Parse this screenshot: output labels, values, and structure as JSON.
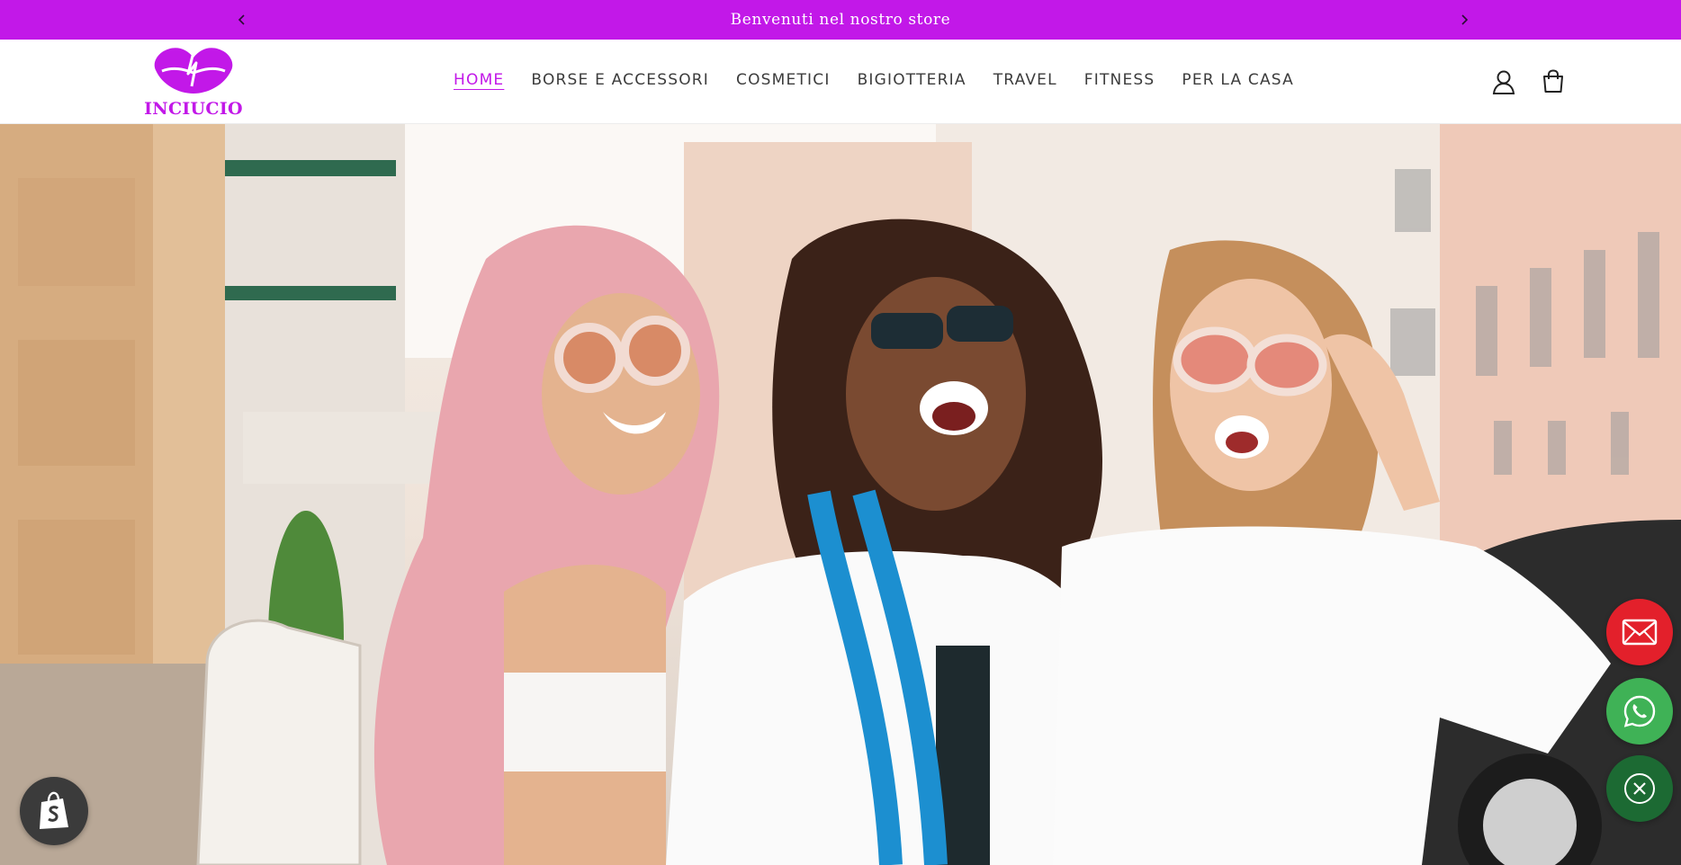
{
  "announcement": {
    "message": "Benvenuti nel nostro store",
    "prev_icon": "chevron-left-icon",
    "next_icon": "chevron-right-icon",
    "background": "#c218e8"
  },
  "header": {
    "logo_text": "INCIUCIO",
    "nav": [
      {
        "label": "HOME",
        "active": true
      },
      {
        "label": "BORSE E ACCESSORI"
      },
      {
        "label": "COSMETICI"
      },
      {
        "label": "BIGIOTTERIA"
      },
      {
        "label": "TRAVEL"
      },
      {
        "label": "FITNESS"
      },
      {
        "label": "PER LA CASA"
      }
    ],
    "icons": [
      "account-icon",
      "cart-icon"
    ],
    "accent": "#c218e8"
  },
  "hero": {
    "image": "three-smiling-women-with-sunglasses-photo"
  },
  "floating_buttons": [
    {
      "icon": "mail-icon",
      "color": "#e3202b"
    },
    {
      "icon": "whatsapp-icon",
      "color": "#3fb256"
    },
    {
      "icon": "close-icon",
      "color": "#1c6a33"
    }
  ],
  "shopify_badge": {
    "icon": "shopify-bag-icon"
  }
}
